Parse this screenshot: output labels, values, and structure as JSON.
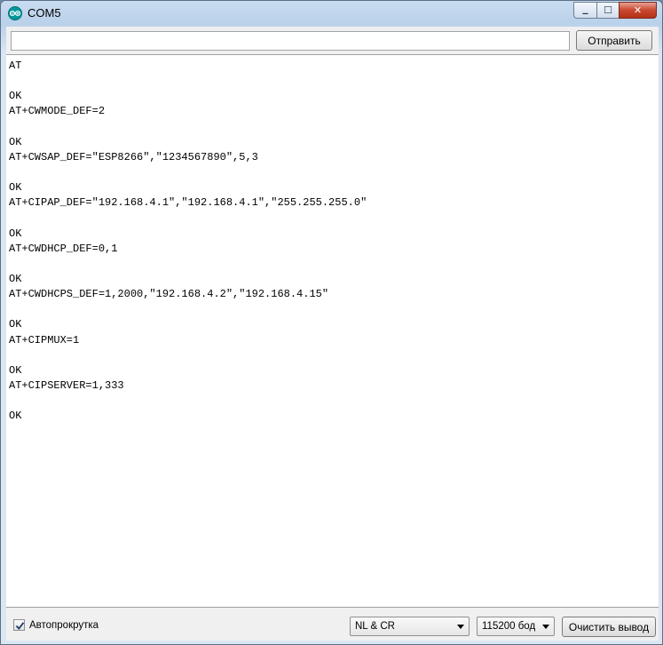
{
  "window": {
    "title": "COM5",
    "controls": {
      "minimize": "▁",
      "maximize": "☐",
      "close": "✕"
    },
    "app_icon": "arduino-icon"
  },
  "send": {
    "input_value": "",
    "input_placeholder": "",
    "button_label": "Отправить"
  },
  "output": {
    "lines": [
      "AT",
      "",
      "OK",
      "AT+CWMODE_DEF=2",
      "",
      "OK",
      "AT+CWSAP_DEF=\"ESP8266\",\"1234567890\",5,3",
      "",
      "OK",
      "AT+CIPAP_DEF=\"192.168.4.1\",\"192.168.4.1\",\"255.255.255.0\"",
      "",
      "OK",
      "AT+CWDHCP_DEF=0,1",
      "",
      "OK",
      "AT+CWDHCPS_DEF=1,2000,\"192.168.4.2\",\"192.168.4.15\"",
      "",
      "OK",
      "AT+CIPMUX=1",
      "",
      "OK",
      "AT+CIPSERVER=1,333",
      "",
      "OK"
    ]
  },
  "bottom": {
    "autoscroll_label": "Автопрокрутка",
    "autoscroll_checked": true,
    "line_ending_value": "NL & CR",
    "baud_value": "115200 бод",
    "clear_button_label": "Очистить вывод"
  },
  "colors": {
    "titlebar": "#b9d1ea",
    "arduino_teal": "#00979c",
    "close_red": "#c9482f"
  }
}
